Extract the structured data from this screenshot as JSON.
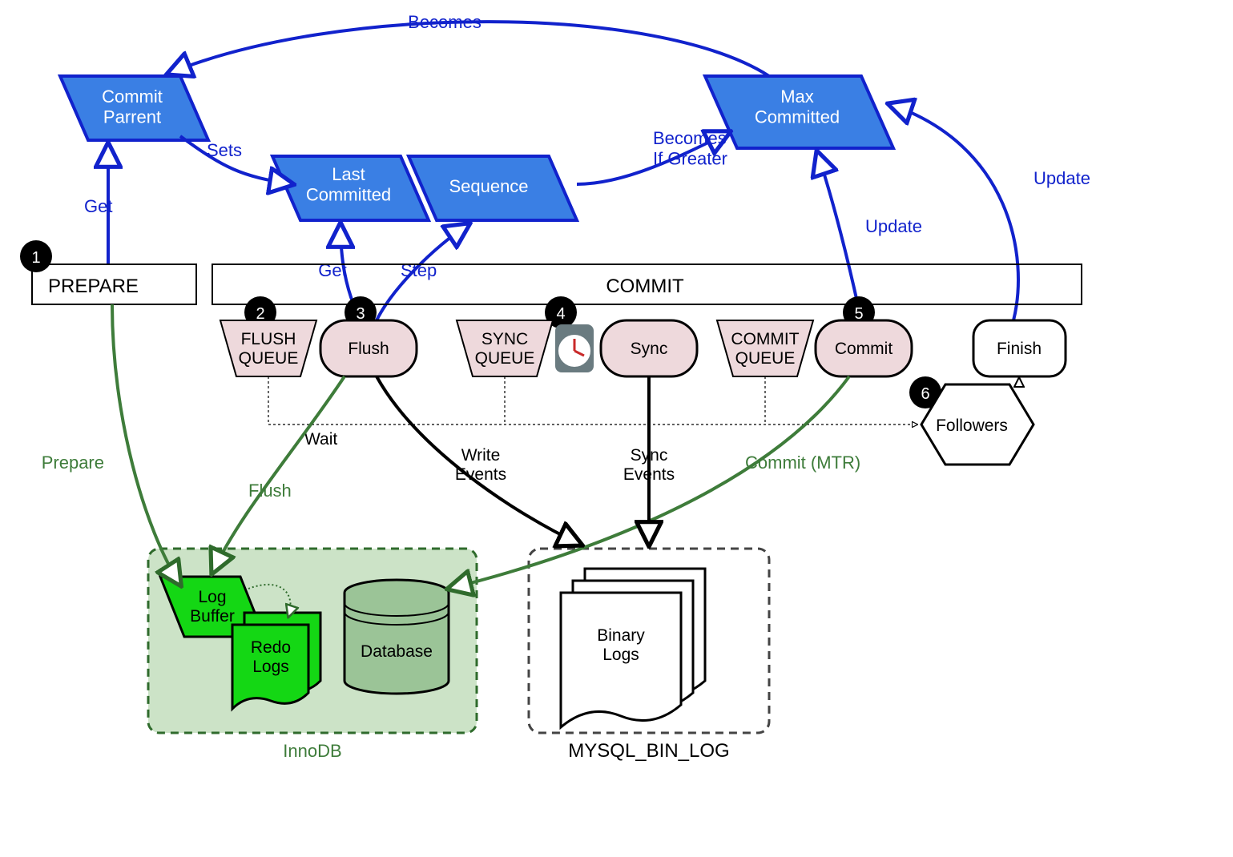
{
  "nodes": {
    "commit_parent": "Commit\nParrent",
    "last_committed": "Last\nCommitted",
    "sequence": "Sequence",
    "max_committed": "Max\nCommitted",
    "prepare": "PREPARE",
    "commit_bar": "COMMIT",
    "flush_queue": "FLUSH\nQUEUE",
    "flush": "Flush",
    "sync_queue": "SYNC\nQUEUE",
    "sync": "Sync",
    "commit_queue": "COMMIT\nQUEUE",
    "commit_round": "Commit",
    "finish": "Finish",
    "followers": "Followers",
    "log_buffer": "Log\nBuffer",
    "redo_logs": "Redo\nLogs",
    "database": "Database",
    "binary_logs": "Binary\nLogs",
    "innodb": "InnoDB",
    "mysql_bin_log": "MYSQL_BIN_LOG"
  },
  "edge_labels": {
    "becomes_top": "Becomes",
    "sets": "Sets",
    "becomes_if_greater": "Becomes\nIf Greater",
    "get_left": "Get",
    "get_mid": "Get",
    "step": "Step",
    "update_right": "Update",
    "update_far_right": "Update",
    "prepare_green": "Prepare",
    "flush_green": "Flush",
    "commit_mtr": "Commit (MTR)",
    "write_events": "Write\nEvents",
    "sync_events": "Sync\nEvents",
    "wait": "Wait"
  },
  "step_numbers": {
    "1": "1",
    "2": "2",
    "3": "3",
    "4": "4",
    "5": "5",
    "6": "6"
  }
}
